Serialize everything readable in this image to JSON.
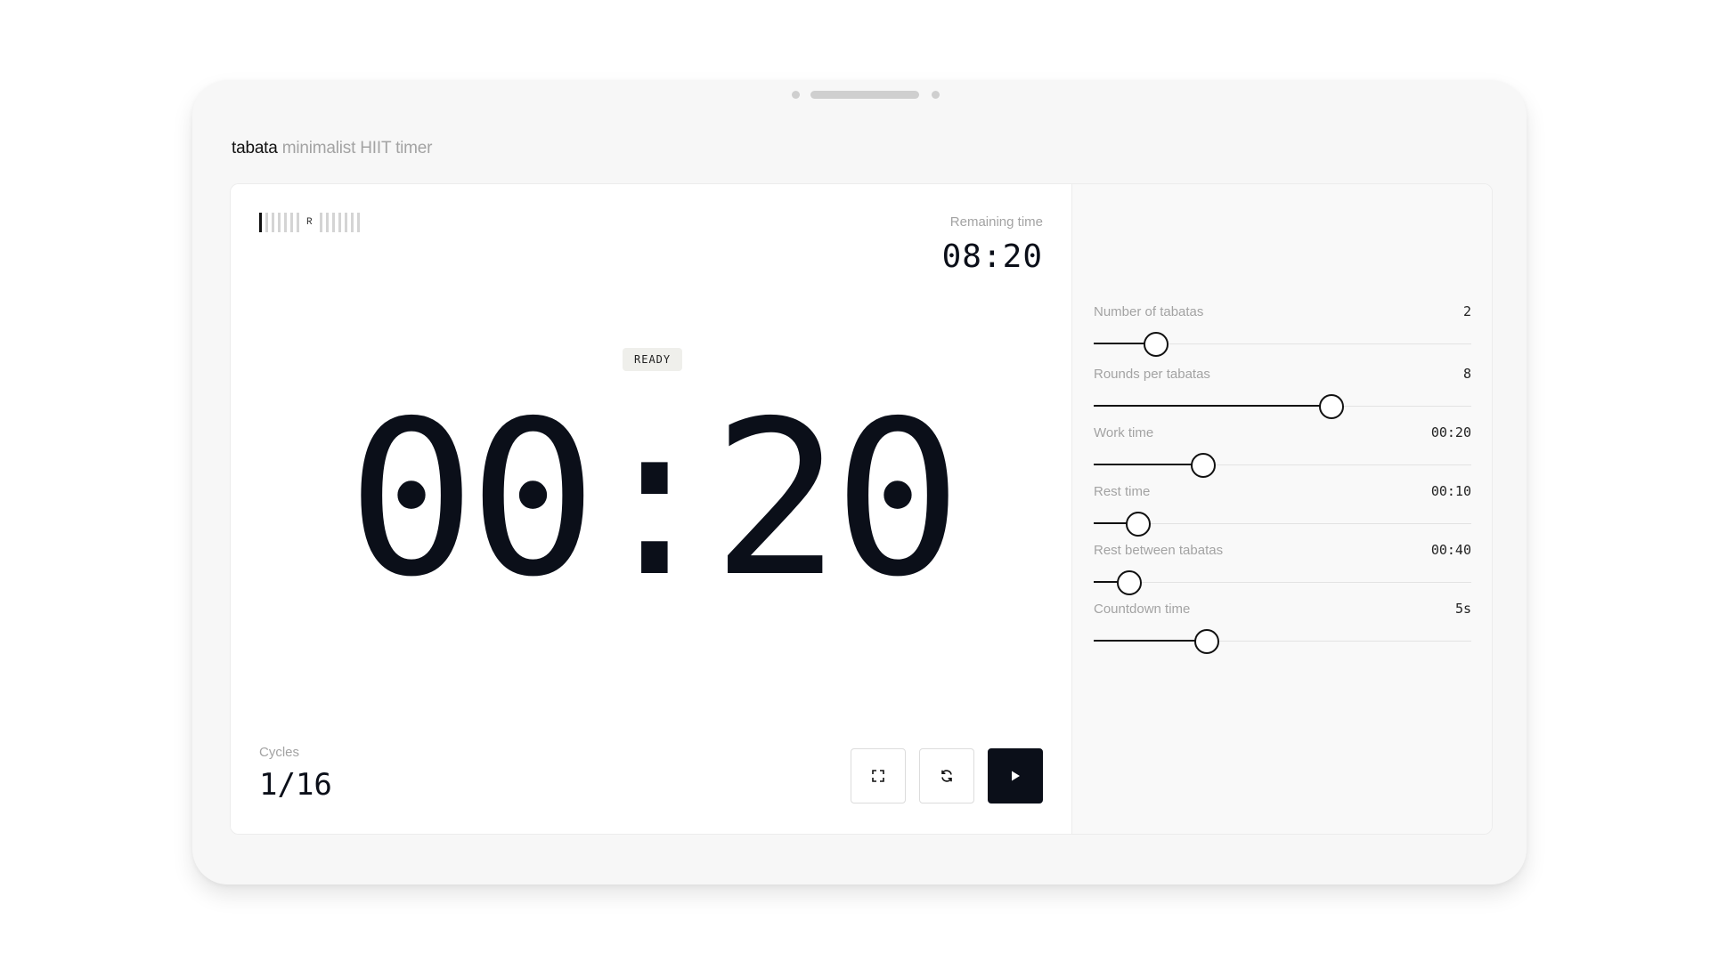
{
  "app": {
    "name": "tabata",
    "tagline": "minimalist HIIT timer"
  },
  "timer": {
    "progress_before_ticks": 7,
    "progress_after_ticks": 7,
    "progress_active_ticks": 1,
    "round_marker": "R",
    "remaining_label": "Remaining time",
    "remaining_value": "08:20",
    "status": "READY",
    "current_time": "00:20",
    "cycles_label": "Cycles",
    "cycles_value": "1/16"
  },
  "controls": {
    "fullscreen_icon": "fullscreen-icon",
    "reset_icon": "reset-icon",
    "play_icon": "play-icon"
  },
  "settings": [
    {
      "id": "tabatas",
      "label": "Number of tabatas",
      "value": "2",
      "level": 0.166
    },
    {
      "id": "rounds",
      "label": "Rounds per tabatas",
      "value": "8",
      "level": 0.63
    },
    {
      "id": "work",
      "label": "Work time",
      "value": "00:20",
      "level": 0.29
    },
    {
      "id": "rest",
      "label": "Rest time",
      "value": "00:10",
      "level": 0.118
    },
    {
      "id": "rest-between",
      "label": "Rest between tabatas",
      "value": "00:40",
      "level": 0.095
    },
    {
      "id": "countdown",
      "label": "Countdown time",
      "value": "5s",
      "level": 0.3
    }
  ],
  "colors": {
    "accent": "#0b0f19",
    "muted": "#a3a3a3",
    "badge_bg": "#efefeb"
  }
}
